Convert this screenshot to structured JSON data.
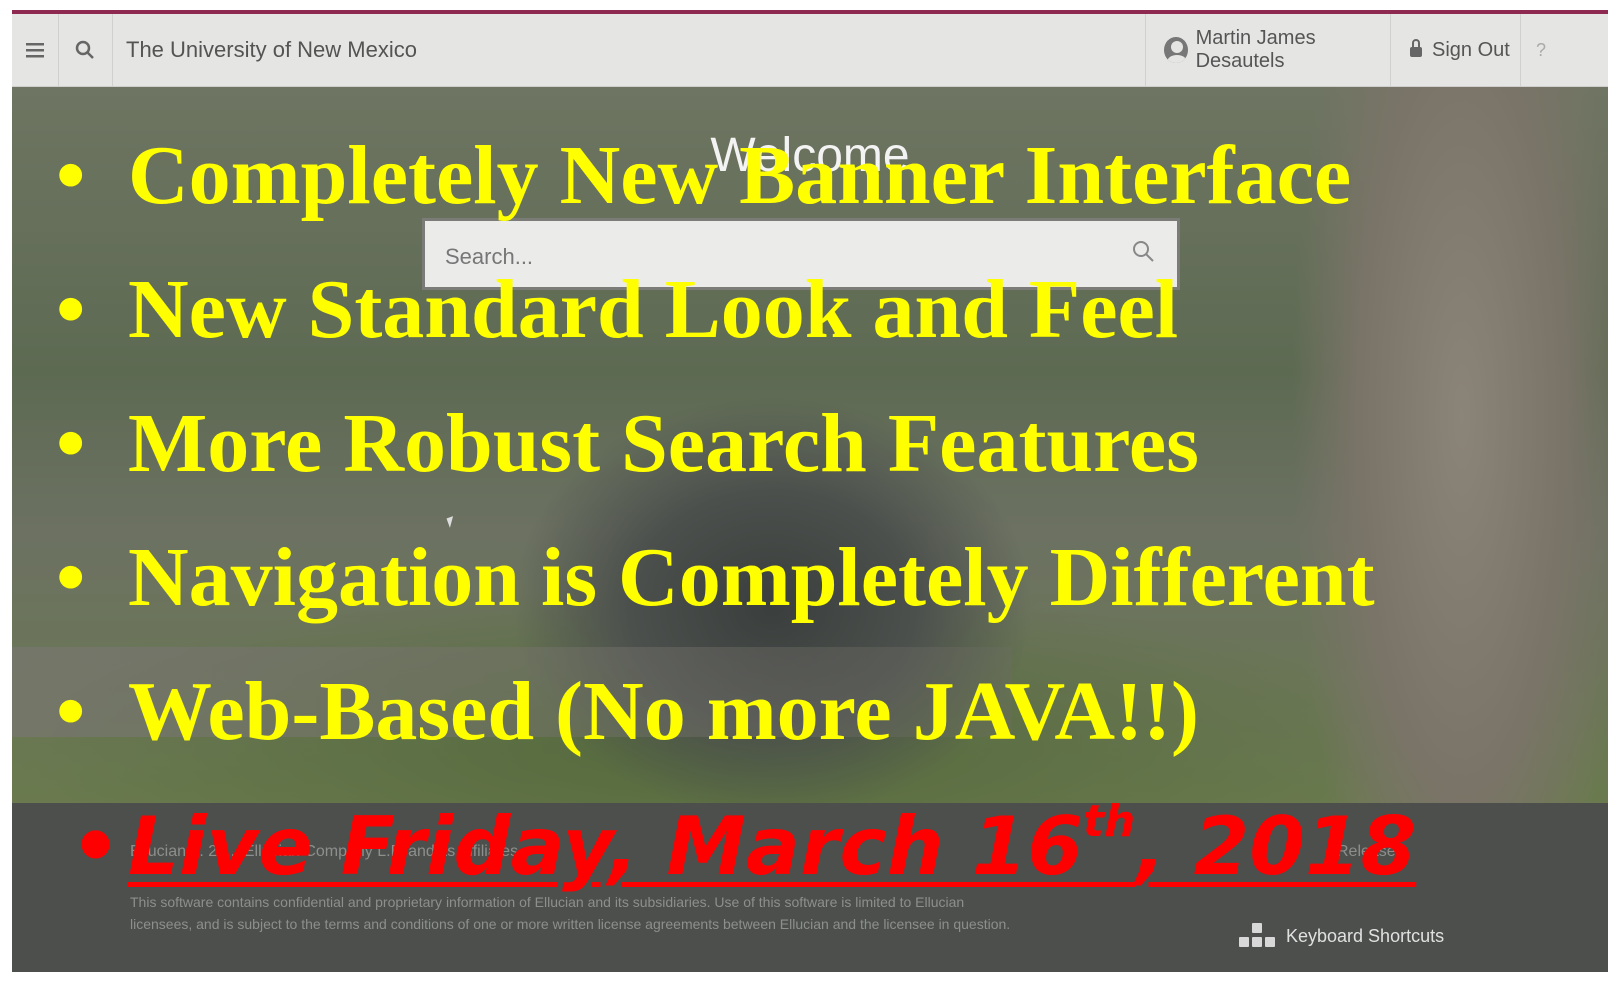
{
  "header": {
    "institution_name": "The University of New Mexico",
    "user_name": "Martin James Desautels",
    "signout_label": "Sign Out",
    "help_label": "?"
  },
  "main": {
    "welcome_title": "Welcome",
    "search_placeholder": "Search..."
  },
  "footer": {
    "copyright_partial": "Ellucian ... 20... Ellucian Company L.P. and its affiliates.",
    "release_partial": "Release:",
    "legal_text": "This software contains confidential and proprietary information of Ellucian and its subsidiaries. Use of this software is limited to Ellucian licensees, and is subject to the terms and conditions of one or more written license agreements between Ellucian and the licensee in question.",
    "shortcuts_label": "Keyboard Shortcuts"
  },
  "slide": {
    "bullet_symbol": "•",
    "bullets": [
      "Completely New Banner Interface",
      "New Standard Look and Feel",
      "More Robust Search Features",
      "Navigation is Completely Different",
      "Web-Based (No more JAVA!!)"
    ],
    "live_main": "Live Friday, March 16",
    "live_sup": "th",
    "live_tail": ", 2018"
  },
  "colors": {
    "bullet_text": "#ffff00",
    "live_text": "#ff0000",
    "accent_bar": "#8e2a52"
  }
}
